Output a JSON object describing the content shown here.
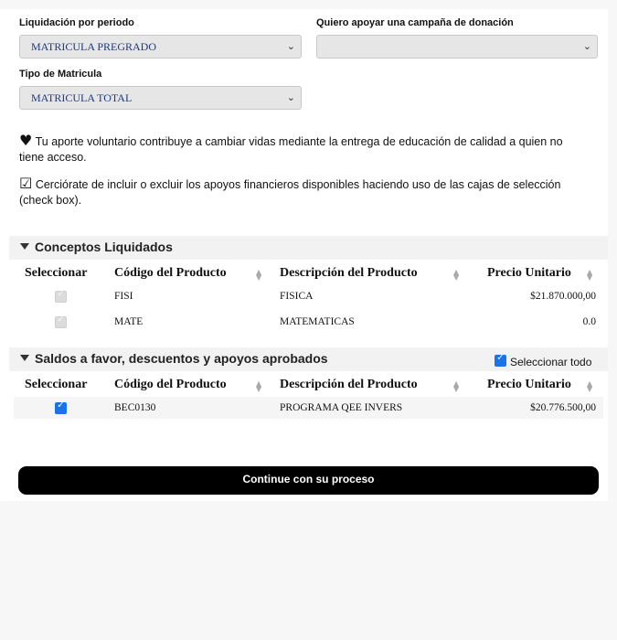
{
  "form": {
    "periodo_label": "Liquidación por periodo",
    "periodo_value": "MATRICULA PREGRADO",
    "campana_label": "Quiero apoyar una campaña de donación",
    "campana_value": "",
    "tipo_label": "Tipo de Matricula",
    "tipo_value": "MATRICULA TOTAL"
  },
  "notes": {
    "aporte_icon": "♥",
    "aporte_text": "Tu aporte voluntario contribuye a cambiar vidas mediante la entrega de educación de calidad a quien no tiene acceso.",
    "check_icon": "☑",
    "check_text": "Cerciórate de incluir o excluir los apoyos financieros disponibles haciendo uso de las cajas de selección (check box)."
  },
  "conceptos": {
    "title": "Conceptos Liquidados",
    "headers": [
      "Seleccionar",
      "Código del Producto",
      "Descripción del Producto",
      "Precio Unitario"
    ],
    "rows": [
      {
        "selected": true,
        "disabled": true,
        "code": "FISI",
        "desc": "FISICA",
        "price": "$21.870.000,00"
      },
      {
        "selected": true,
        "disabled": true,
        "code": "MATE",
        "desc": "MATEMATICAS",
        "price": "0.0"
      }
    ]
  },
  "saldos": {
    "title": "Saldos a favor, descuentos y apoyos aprobados",
    "select_all_label": "Seleccionar todo",
    "select_all_checked": true,
    "headers": [
      "Seleccionar",
      "Código del Producto",
      "Descripción del Producto",
      "Precio Unitario"
    ],
    "rows": [
      {
        "selected": true,
        "disabled": false,
        "code": "BEC0130",
        "desc": "PROGRAMA QEE INVERS",
        "price": "$20.776.500,00"
      }
    ]
  },
  "actions": {
    "continue_label": "Continue con su proceso"
  },
  "colors": {
    "checkbox_accent": "#1a73e8",
    "button_bg": "#000000",
    "select_text": "#1f3a7a"
  }
}
